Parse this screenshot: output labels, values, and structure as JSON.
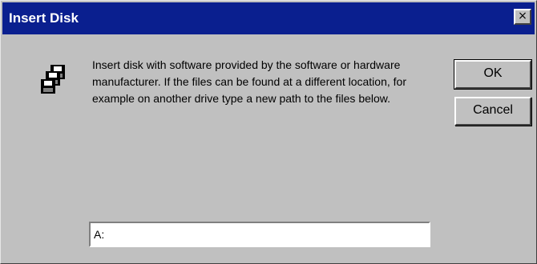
{
  "window": {
    "title": "Insert Disk",
    "close_label": "×"
  },
  "dialog": {
    "message": "Insert disk with software provided by the software or hardware manufacturer.  If the files can be found at a different location, for example on another drive type a new path to the files below.",
    "path_value": "A:",
    "ok_label": "OK",
    "cancel_label": "Cancel",
    "icon": "floppy-disks-icon"
  },
  "colors": {
    "titlebar": "#0a1f8f",
    "face": "#c0c0c0"
  }
}
